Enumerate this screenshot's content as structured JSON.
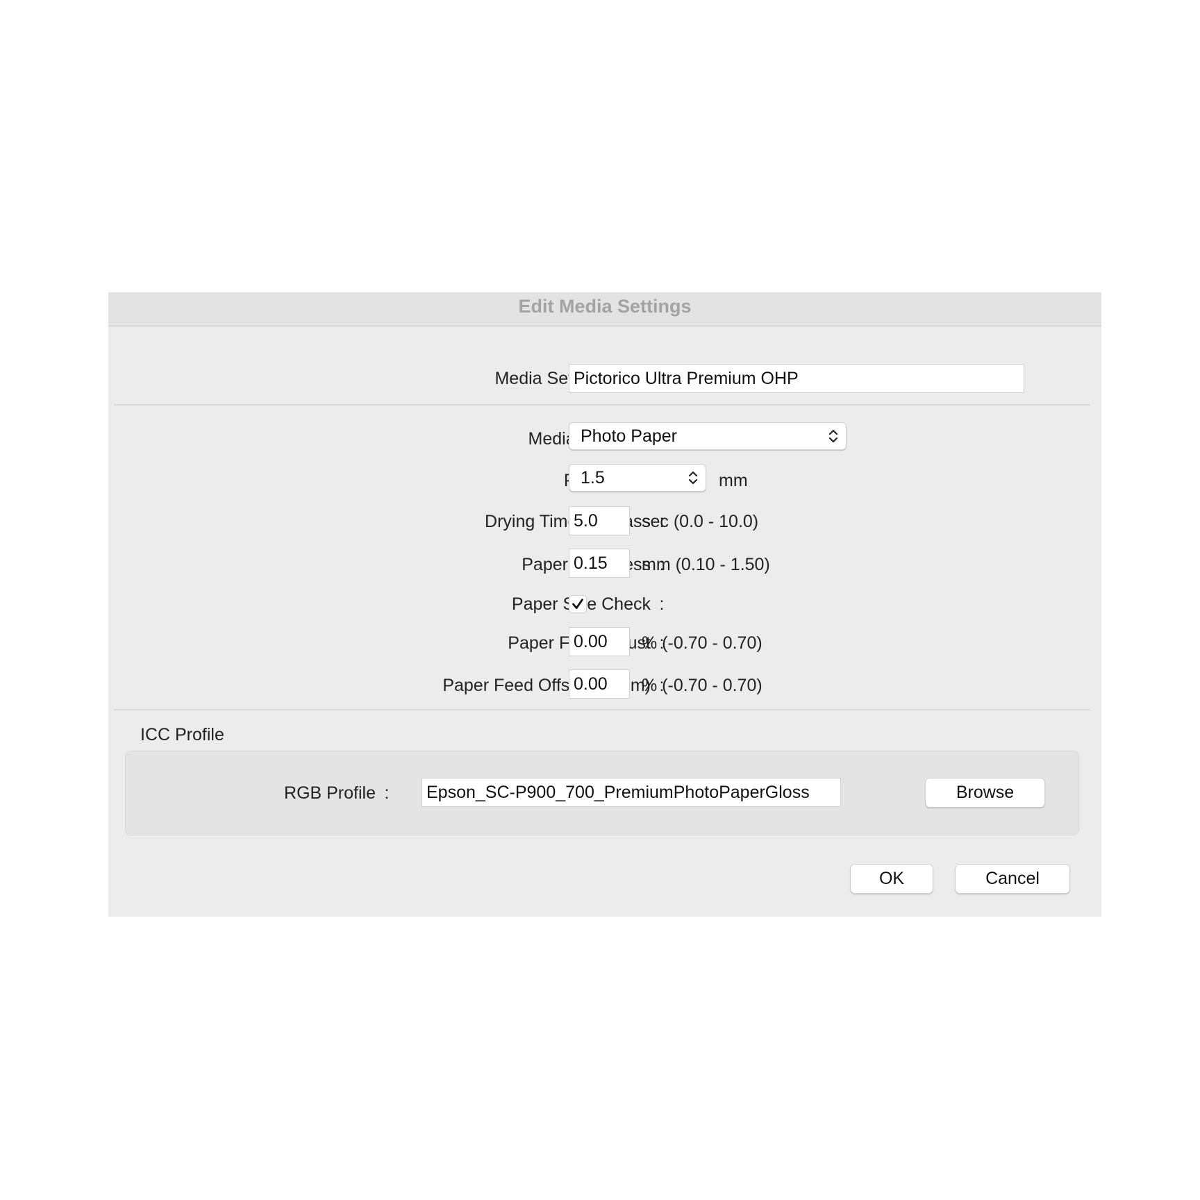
{
  "dialog": {
    "title": "Edit Media Settings"
  },
  "form": {
    "colon": ":",
    "media_setting_name": {
      "label": "Media Setting Name",
      "value": "Pictorico Ultra Premium OHP"
    },
    "media_category": {
      "label": "Media Category",
      "selected": "Photo Paper"
    },
    "platen_gap": {
      "label": "Platen Gap",
      "selected": "1.5",
      "unit": "mm"
    },
    "drying_time": {
      "label": "Drying Time per Pass",
      "value": "5.0",
      "range": "sec (0.0 - 10.0)"
    },
    "paper_thickness": {
      "label": "Paper Thickness",
      "value": "0.15",
      "range": "mm (0.10 - 1.50)"
    },
    "paper_size_check": {
      "label": "Paper Size Check",
      "checked": true
    },
    "paper_feed_adjust": {
      "label": "Paper Feed Adjust",
      "value": "0.00",
      "range": "% (-0.70 - 0.70)"
    },
    "paper_feed_offset": {
      "label": "Paper Feed Offset(Bottom)",
      "value": "0.00",
      "range": "% (-0.70 - 0.70)"
    }
  },
  "icc": {
    "section_title": "ICC Profile",
    "rgb_label": "RGB Profile",
    "rgb_value": "Epson_SC-P900_700_PremiumPhotoPaperGloss",
    "browse_label": "Browse"
  },
  "footer": {
    "ok_label": "OK",
    "cancel_label": "Cancel"
  }
}
